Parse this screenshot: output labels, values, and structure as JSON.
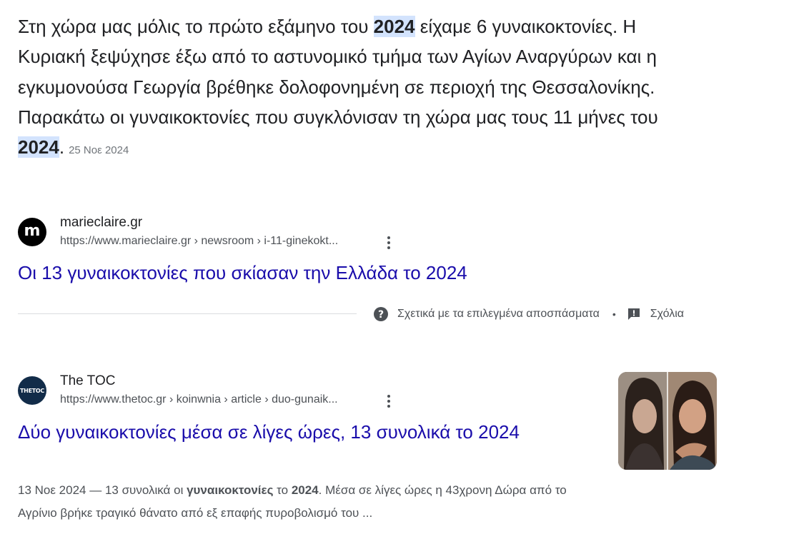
{
  "featured_snippet": {
    "text_1": "Στη χώρα μας μόλις το πρώτο εξάμηνο του ",
    "highlight_1": "2024",
    "text_2": " είχαμε 6 γυναικοκτονίες. Η Κυριακή ξεψύχησε έξω από το αστυνομικό τμήμα των Αγίων Αναργύρων και η εγκυμονούσα Γεωργία βρέθηκε δολοφονημένη σε περιοχή της Θεσσαλονίκης. Παρακάτω οι γυναικοκτονίες που συγκλόνισαν τη χώρα μας τους 11 μήνες του ",
    "highlight_2": "2024",
    "text_3": ".",
    "date": "25 Νοε 2024"
  },
  "results": [
    {
      "site_name": "marieclaire.gr",
      "favicon_letter": "m",
      "url": "https://www.marieclaire.gr › newsroom › i-11-ginekokt...",
      "title": "Οι 13 γυναικοκτονίες που σκίασαν την Ελλάδα το 2024",
      "favicon_color": "#000000"
    },
    {
      "site_name": "The TOC",
      "favicon_letter": "THETOC",
      "url": "https://www.thetoc.gr › koinwnia › article › duo-gunaik...",
      "title": "Δύο γυναικοκτονίες μέσα σε λίγες ώρες, 13 συνολικά το 2024",
      "desc_date": "13 Νοε 2024",
      "desc_sep": " — ",
      "desc_a": "13 συνολικά οι ",
      "desc_b1": "γυναικοκτονίες",
      "desc_c": " το ",
      "desc_b2": "2024",
      "desc_d": ". Μέσα σε λίγες ώρες η 43χρονη Δώρα από το Αγρίνιο βρήκε τραγικό θάνατο από εξ επαφής πυροβολισμό του ...",
      "favicon_color": "#122c49"
    }
  ],
  "about_row": {
    "about_label": "Σχετικά με τα επιλεγμένα αποσπάσματα",
    "separator": "•",
    "feedback_label": "Σχόλια",
    "about_icon": "help-circle-icon",
    "feedback_icon": "feedback-icon"
  },
  "colors": {
    "link": "#1a0dab",
    "highlight_bg": "#d3e3fd",
    "text": "#202124",
    "secondary": "#4d5156"
  }
}
